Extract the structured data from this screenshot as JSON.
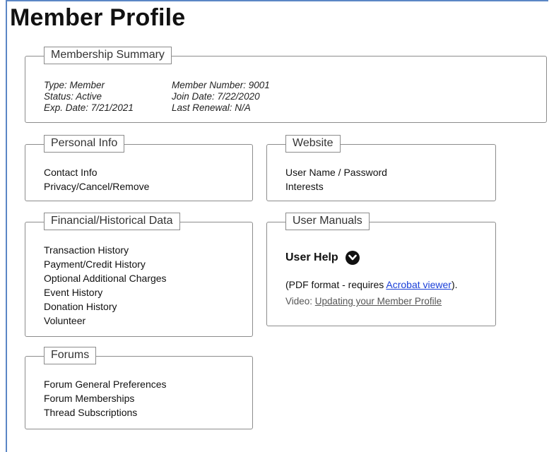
{
  "page_title": "Member Profile",
  "summary": {
    "legend": "Membership Summary",
    "type": "Type: Member",
    "status": "Status: Active",
    "exp_date": "Exp. Date: 7/21/2021",
    "member_number": "Member Number: 9001",
    "join_date": "Join Date: 7/22/2020",
    "last_renewal": "Last Renewal: N/A"
  },
  "personal": {
    "legend": "Personal Info",
    "items": [
      "Contact Info",
      "Privacy/Cancel/Remove"
    ]
  },
  "website": {
    "legend": "Website",
    "items": [
      "User Name / Password",
      "Interests"
    ]
  },
  "financial": {
    "legend": "Financial/Historical Data",
    "items": [
      "Transaction History",
      "Payment/Credit History",
      "Optional Additional Charges",
      "Event History",
      "Donation History",
      "Volunteer"
    ]
  },
  "manuals": {
    "legend": "User Manuals",
    "help_title": "User Help",
    "help_icon": "chevron-down-circle-icon",
    "pdf_prefix": "(PDF format - requires ",
    "pdf_link": "Acrobat viewer",
    "pdf_suffix": ").",
    "video_prefix": "Video: ",
    "video_link": "Updating your Member Profile"
  },
  "forums": {
    "legend": "Forums",
    "items": [
      "Forum General Preferences",
      "Forum Memberships",
      "Thread Subscriptions"
    ]
  },
  "colors": {
    "frame_accent": "#5b86c5",
    "link_blue": "#1a3fd8",
    "panel_border": "#8c8c8c"
  }
}
